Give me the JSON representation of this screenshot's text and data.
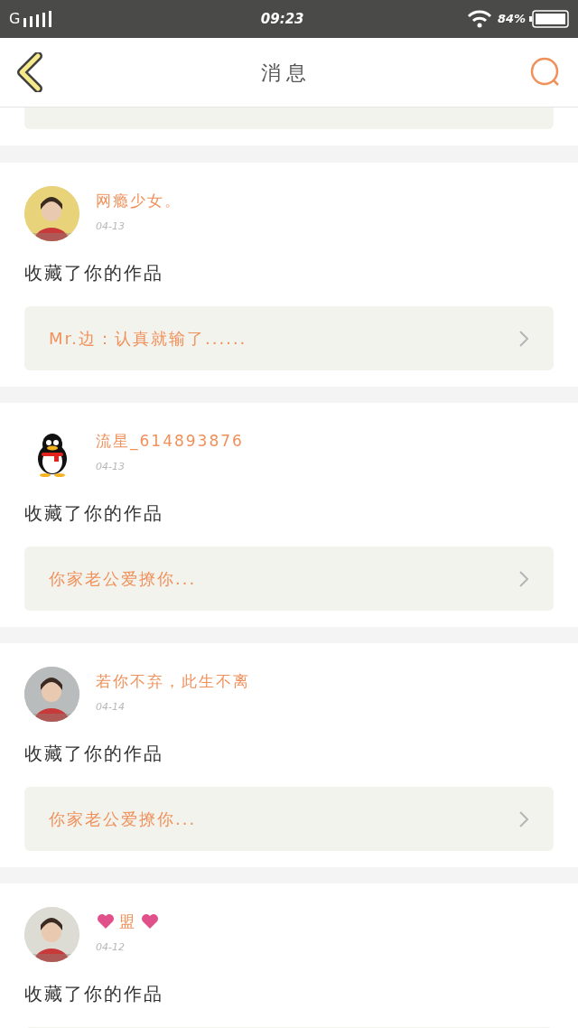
{
  "status_bar": {
    "network": "G",
    "time": "09:23",
    "battery": "84%"
  },
  "header": {
    "title": "消息"
  },
  "messages": [
    {
      "color": "#e8d27a",
      "name": "网瘾少女。",
      "hearts": false,
      "date": "04-13",
      "action": "收藏了你的作品",
      "work": "Mr.边：认真就输了......"
    },
    {
      "kind": "penguin",
      "name": "流星_614893876",
      "hearts": false,
      "date": "04-13",
      "action": "收藏了你的作品",
      "work": "你家老公爱撩你..."
    },
    {
      "color": "#b9bcbd",
      "name": "若你不弃，此生不离",
      "hearts": false,
      "date": "04-14",
      "action": "收藏了你的作品",
      "work": "你家老公爱撩你..."
    },
    {
      "color": "#dcdcd4",
      "name": "盟",
      "hearts": true,
      "date": "04-12",
      "action": "收藏了你的作品"
    }
  ]
}
